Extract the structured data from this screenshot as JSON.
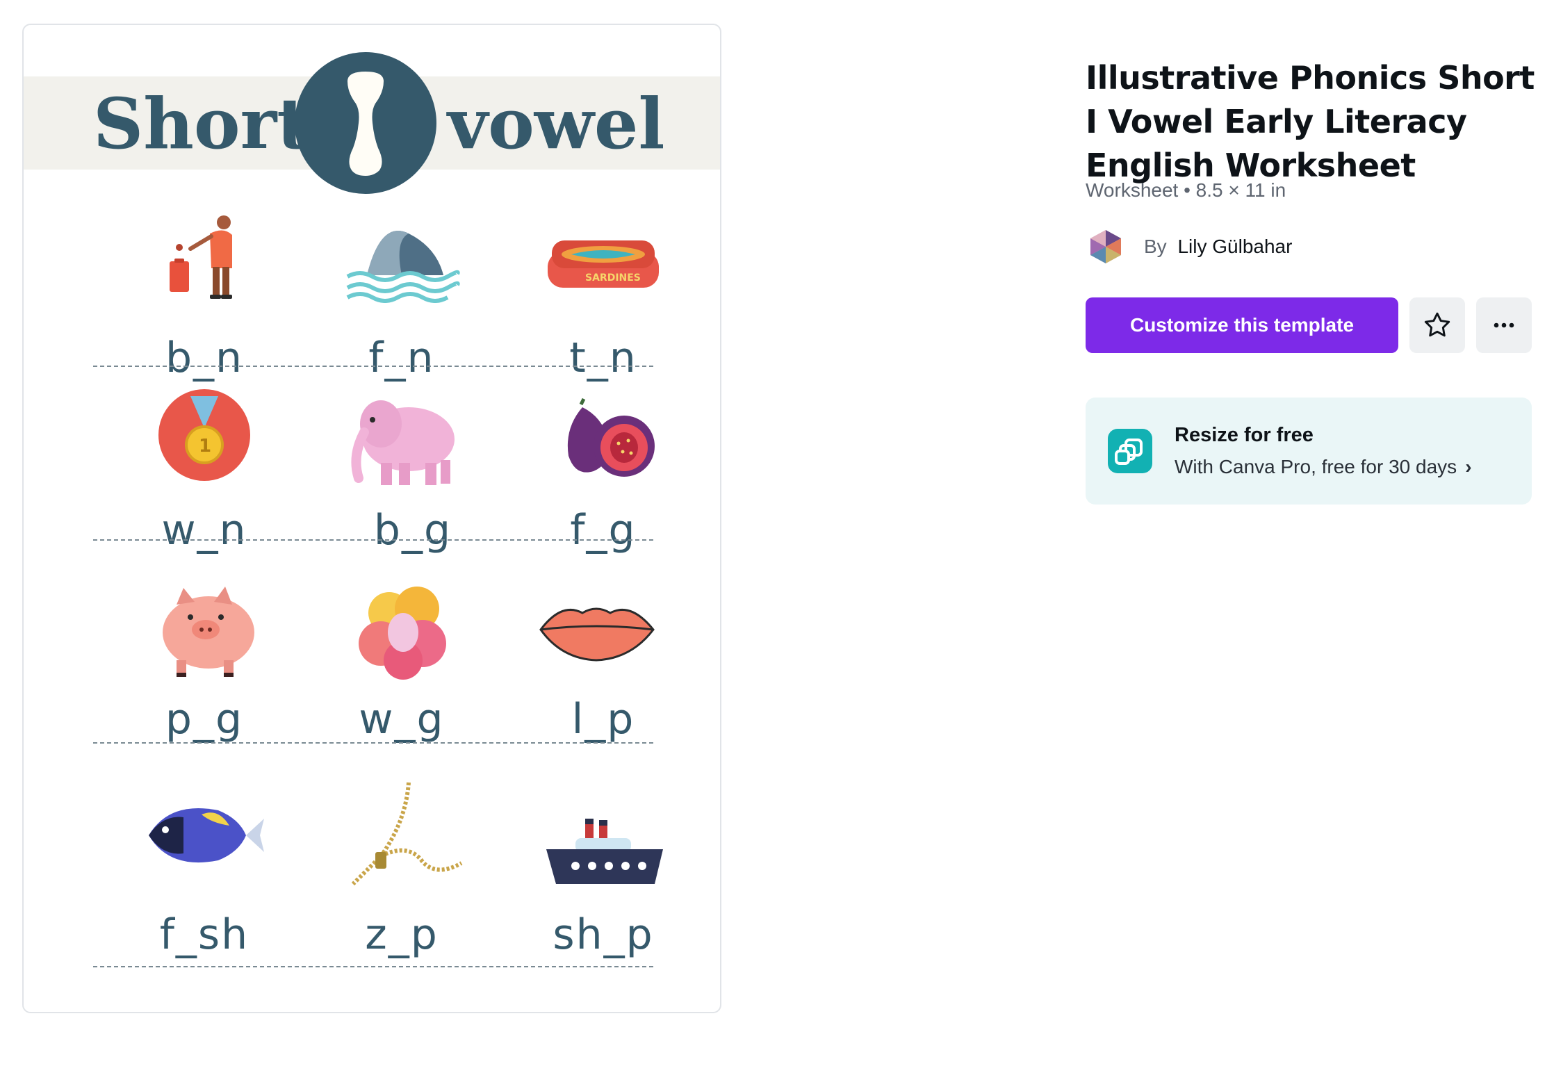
{
  "worksheet": {
    "heading_left": "Short",
    "heading_right": "vowel",
    "heading_letter_icon": "letter-i-icon",
    "rows": [
      {
        "cells": [
          {
            "icon": "man-throwing-trash-icon",
            "word": "b_n"
          },
          {
            "icon": "shark-fin-icon",
            "word": "f_n"
          },
          {
            "icon": "sardine-tin-icon",
            "word": "t_n"
          }
        ]
      },
      {
        "cells": [
          {
            "icon": "gold-medal-icon",
            "word": "w_n"
          },
          {
            "icon": "elephant-icon",
            "word": "b_g"
          },
          {
            "icon": "fig-icon",
            "word": "f_g"
          }
        ]
      },
      {
        "cells": [
          {
            "icon": "pig-icon",
            "word": "p_g"
          },
          {
            "icon": "wig-icon",
            "word": "w_g"
          },
          {
            "icon": "lips-icon",
            "word": "l_p"
          }
        ]
      },
      {
        "cells": [
          {
            "icon": "fish-icon",
            "word": "f_sh"
          },
          {
            "icon": "zipper-icon",
            "word": "z_p"
          },
          {
            "icon": "ship-icon",
            "word": "sh_p"
          }
        ]
      }
    ],
    "sardine_label": "SARDINES",
    "medal_number": "1"
  },
  "template": {
    "title": "Illustrative Phonics Short I Vowel Early Literacy English Worksheet",
    "meta": "Worksheet • 8.5 × 11 in",
    "author_prefix": "By",
    "author_name": "Lily Gülbahar",
    "customize_label": "Customize this template",
    "star_icon": "star-outline-icon",
    "more_icon": "more-horizontal-icon"
  },
  "resize": {
    "title": "Resize for free",
    "subtitle": "With Canva Pro, free for 30 days",
    "chevron": "›",
    "icon": "resize-icon"
  },
  "colors": {
    "accent_purple": "#7d2ae8",
    "worksheet_ink": "#35596b",
    "banner_bg": "#f2f1ec",
    "resize_bg": "#eaf6f7",
    "resize_icon_bg": "#12b1b3"
  }
}
